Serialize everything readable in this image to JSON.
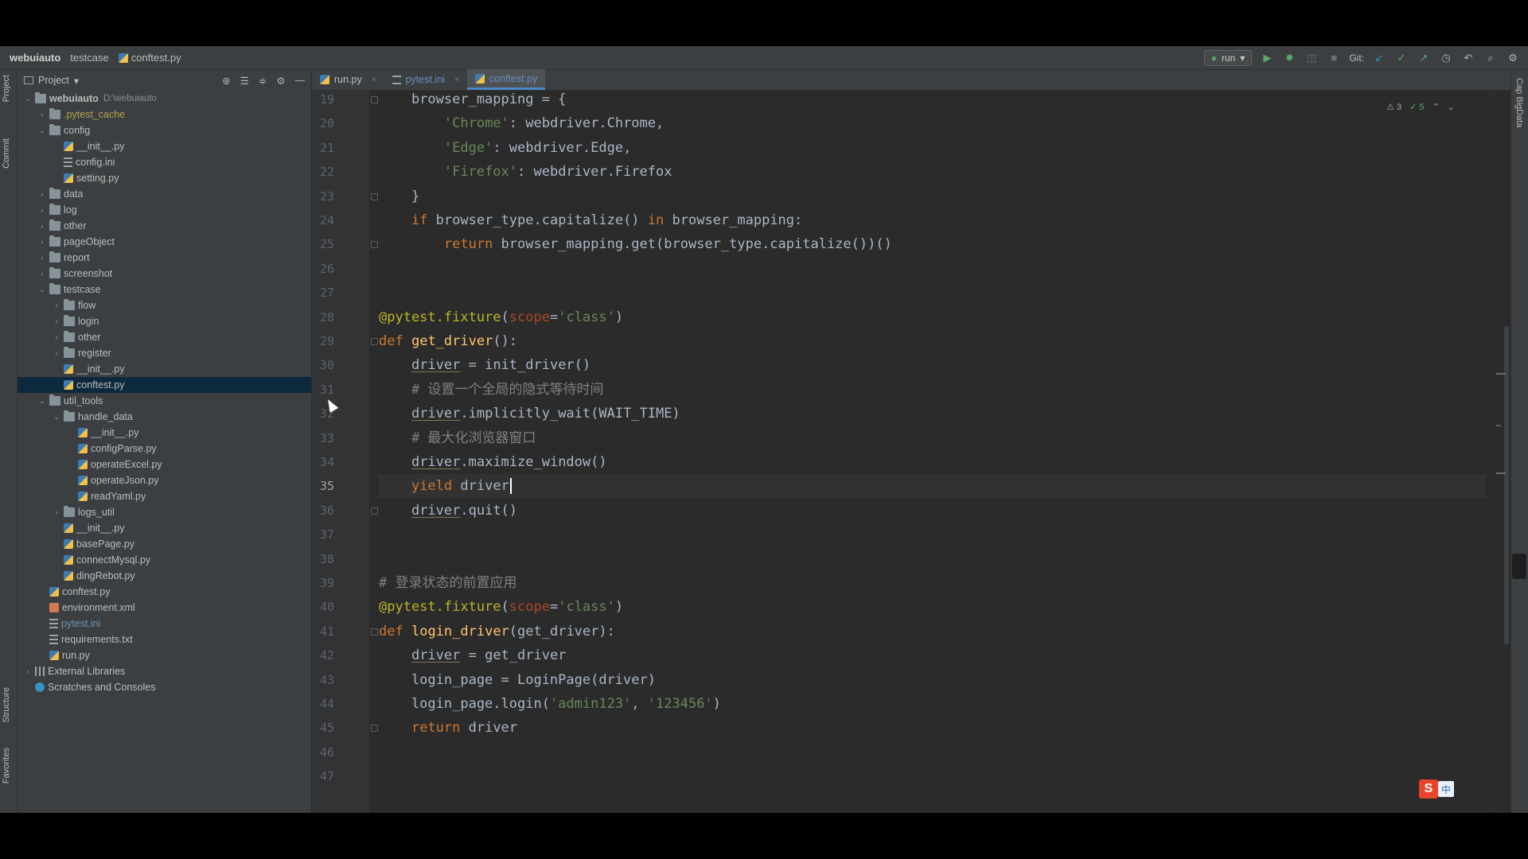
{
  "navbar": {
    "crumbs": [
      "webuiauto",
      "testcase",
      "conftest.py"
    ],
    "run_config": "run",
    "git_label": "Git:"
  },
  "tool_strip": {
    "left": [
      "Project",
      "Commit",
      "Structure",
      "Favorites"
    ],
    "right": "Cap BigData"
  },
  "project": {
    "header_label": "Project",
    "tree": [
      {
        "label": "webuiauto",
        "path": "D:\\webuiauto",
        "depth": 0,
        "type": "folder",
        "expanded": true,
        "bold": true
      },
      {
        "label": ".pytest_cache",
        "depth": 1,
        "type": "folder",
        "expanded": false,
        "style": "muted"
      },
      {
        "label": "config",
        "depth": 1,
        "type": "folder",
        "expanded": true
      },
      {
        "label": "__init__.py",
        "depth": 2,
        "type": "py"
      },
      {
        "label": "config.ini",
        "depth": 2,
        "type": "ini"
      },
      {
        "label": "setting.py",
        "depth": 2,
        "type": "py"
      },
      {
        "label": "data",
        "depth": 1,
        "type": "folder",
        "expanded": false
      },
      {
        "label": "log",
        "depth": 1,
        "type": "folder",
        "expanded": false
      },
      {
        "label": "other",
        "depth": 1,
        "type": "folder",
        "expanded": false
      },
      {
        "label": "pageObject",
        "depth": 1,
        "type": "folder",
        "expanded": false
      },
      {
        "label": "report",
        "depth": 1,
        "type": "folder",
        "expanded": false
      },
      {
        "label": "screenshot",
        "depth": 1,
        "type": "folder",
        "expanded": false
      },
      {
        "label": "testcase",
        "depth": 1,
        "type": "folder",
        "expanded": true
      },
      {
        "label": "flow",
        "depth": 2,
        "type": "folder",
        "expanded": false
      },
      {
        "label": "login",
        "depth": 2,
        "type": "folder",
        "expanded": false
      },
      {
        "label": "other",
        "depth": 2,
        "type": "folder",
        "expanded": false
      },
      {
        "label": "register",
        "depth": 2,
        "type": "folder",
        "expanded": false
      },
      {
        "label": "__init__.py",
        "depth": 2,
        "type": "py"
      },
      {
        "label": "conftest.py",
        "depth": 2,
        "type": "py",
        "selected": true
      },
      {
        "label": "util_tools",
        "depth": 1,
        "type": "folder",
        "expanded": true
      },
      {
        "label": "handle_data",
        "depth": 2,
        "type": "folder",
        "expanded": true
      },
      {
        "label": "__init__.py",
        "depth": 3,
        "type": "py"
      },
      {
        "label": "configParse.py",
        "depth": 3,
        "type": "py"
      },
      {
        "label": "operateExcel.py",
        "depth": 3,
        "type": "py"
      },
      {
        "label": "operateJson.py",
        "depth": 3,
        "type": "py"
      },
      {
        "label": "readYaml.py",
        "depth": 3,
        "type": "py"
      },
      {
        "label": "logs_util",
        "depth": 2,
        "type": "folder",
        "expanded": false
      },
      {
        "label": "__init__.py",
        "depth": 2,
        "type": "py"
      },
      {
        "label": "basePage.py",
        "depth": 2,
        "type": "py"
      },
      {
        "label": "connectMysql.py",
        "depth": 2,
        "type": "py"
      },
      {
        "label": "dingRebot.py",
        "depth": 2,
        "type": "py"
      },
      {
        "label": "conftest.py",
        "depth": 1,
        "type": "py"
      },
      {
        "label": "environment.xml",
        "depth": 1,
        "type": "xml"
      },
      {
        "label": "pytest.ini",
        "depth": 1,
        "type": "ini",
        "style": "blue"
      },
      {
        "label": "requirements.txt",
        "depth": 1,
        "type": "ini"
      },
      {
        "label": "run.py",
        "depth": 1,
        "type": "py"
      },
      {
        "label": "External Libraries",
        "depth": 0,
        "type": "lib",
        "expanded": false
      },
      {
        "label": "Scratches and Consoles",
        "depth": 0,
        "type": "scratch"
      }
    ]
  },
  "tabs": [
    {
      "label": "run.py",
      "type": "py"
    },
    {
      "label": "pytest.ini",
      "type": "ini"
    },
    {
      "label": "conftest.py",
      "type": "py",
      "active": true
    }
  ],
  "editor": {
    "indicators": {
      "warnings": "3",
      "ok": "5"
    },
    "current_line": 35,
    "lines": [
      {
        "n": 19,
        "html": "    browser_mapping = {"
      },
      {
        "n": 20,
        "html": "        <span class='str'>'Chrome'</span>: webdriver.Chrome,"
      },
      {
        "n": 21,
        "html": "        <span class='str'>'Edge'</span>: webdriver.Edge,"
      },
      {
        "n": 22,
        "html": "        <span class='str'>'Firefox'</span>: webdriver.Firefox"
      },
      {
        "n": 23,
        "html": "    }"
      },
      {
        "n": 24,
        "html": "    <span class='kw'>if</span> browser_type.capitalize() <span class='kw'>in</span> browser_mapping:"
      },
      {
        "n": 25,
        "html": "        <span class='kw'>return</span> browser_mapping.get(browser_type.capitalize())()"
      },
      {
        "n": 26,
        "html": ""
      },
      {
        "n": 27,
        "html": ""
      },
      {
        "n": 28,
        "html": "<span class='deco'>@pytest.fixture</span>(<span class='param'>scope</span>=<span class='str'>'class'</span>)"
      },
      {
        "n": 29,
        "html": "<span class='kw'>def</span> <span class='fn'>get_driver</span>():"
      },
      {
        "n": 30,
        "html": "    <span class='ul'>driver</span> = init_driver()"
      },
      {
        "n": 31,
        "html": "    <span class='com'># 设置一个全局的隐式等待时间</span>"
      },
      {
        "n": 32,
        "html": "    <span class='ul'>driver</span>.implicitly_wait(WAIT_TIME)"
      },
      {
        "n": 33,
        "html": "    <span class='com'># 最大化浏览器窗口</span>"
      },
      {
        "n": 34,
        "html": "    <span class='ul'>driver</span>.maximize_window()"
      },
      {
        "n": 35,
        "html": "    <span class='kw'>yield</span> driver<span class='caret'></span>"
      },
      {
        "n": 36,
        "html": "    <span class='ul'>driver</span>.quit()"
      },
      {
        "n": 37,
        "html": ""
      },
      {
        "n": 38,
        "html": ""
      },
      {
        "n": 39,
        "html": "<span class='com'># 登录状态的前置应用</span>"
      },
      {
        "n": 40,
        "html": "<span class='deco'>@pytest.fixture</span>(<span class='param'>scope</span>=<span class='str'>'class'</span>)"
      },
      {
        "n": 41,
        "html": "<span class='kw'>def</span> <span class='fn'>login_driver</span>(get_driver):"
      },
      {
        "n": 42,
        "html": "    <span class='ul'>driver</span> = get_driver"
      },
      {
        "n": 43,
        "html": "    login_page = LoginPage(driver)"
      },
      {
        "n": 44,
        "html": "    login_page.login(<span class='str'>'admin123'</span>, <span class='str'>'123456'</span>)"
      },
      {
        "n": 45,
        "html": "    <span class='kw'>return</span> driver"
      },
      {
        "n": 46,
        "html": ""
      },
      {
        "n": 47,
        "html": ""
      }
    ],
    "fold_lines": [
      19,
      23,
      25,
      29,
      36,
      41,
      45
    ]
  },
  "ime": {
    "s": "S",
    "zh": "中"
  },
  "colors": {
    "selection": "#0d293e",
    "keyword": "#cc7832",
    "string": "#6a8759",
    "decorator": "#bbb529",
    "function": "#ffc66d"
  }
}
